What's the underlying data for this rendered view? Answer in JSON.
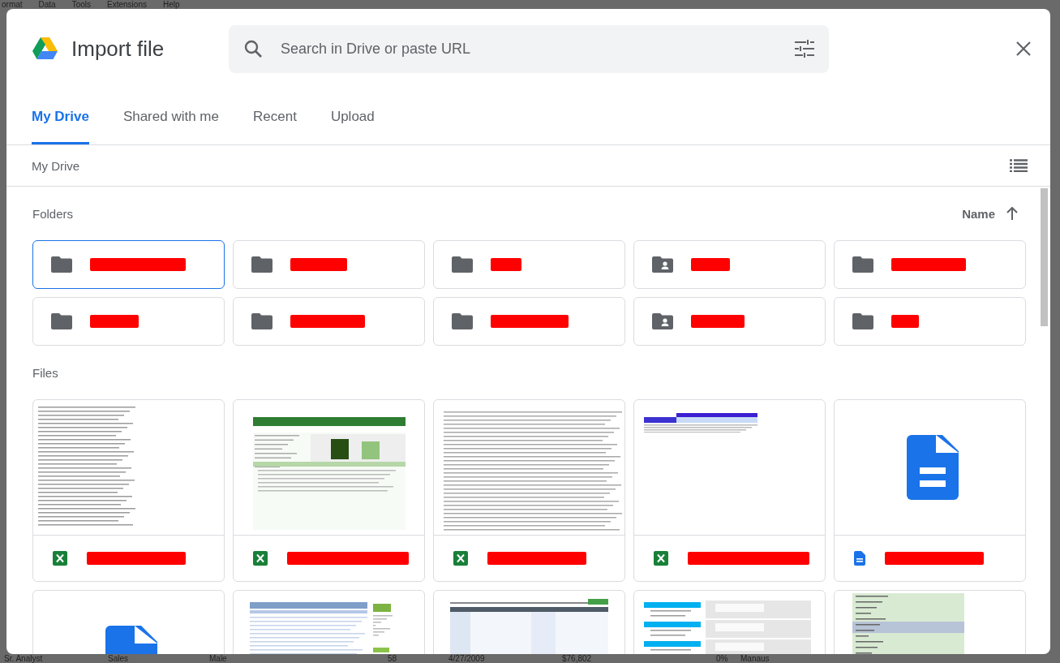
{
  "background": {
    "menu": [
      "ormat",
      "Data",
      "Tools",
      "Extensions",
      "Help"
    ],
    "row": [
      "Sr. Analyst",
      "Sales",
      "Male",
      "58",
      "4/27/2009",
      "$76,802",
      "0%",
      "Manaus"
    ]
  },
  "dialog": {
    "title": "Import file",
    "search": {
      "placeholder": "Search in Drive or paste URL"
    },
    "tabs": [
      {
        "label": "My Drive",
        "selected": true
      },
      {
        "label": "Shared with me",
        "selected": false
      },
      {
        "label": "Recent",
        "selected": false
      },
      {
        "label": "Upload",
        "selected": false
      }
    ],
    "breadcrumb": "My Drive",
    "folders_heading": "Folders",
    "sort": {
      "label": "Name"
    },
    "folders": [
      {
        "kind": "folder",
        "selected": true
      },
      {
        "kind": "folder",
        "selected": false
      },
      {
        "kind": "folder",
        "selected": false
      },
      {
        "kind": "shared",
        "selected": false
      },
      {
        "kind": "folder",
        "selected": false
      },
      {
        "kind": "folder",
        "selected": false
      },
      {
        "kind": "folder",
        "selected": false
      },
      {
        "kind": "folder",
        "selected": false
      },
      {
        "kind": "shared",
        "selected": false
      },
      {
        "kind": "folder",
        "selected": false
      }
    ],
    "files_heading": "Files",
    "files": [
      {
        "kind": "sheet-list",
        "name_redacted": true
      },
      {
        "kind": "sheet-debt",
        "name_redacted": true
      },
      {
        "kind": "sheet-dense",
        "name_redacted": true
      },
      {
        "kind": "sheet-table",
        "name_redacted": true
      },
      {
        "kind": "doc",
        "name_redacted": true
      },
      {
        "kind": "file"
      },
      {
        "kind": "ledger"
      },
      {
        "kind": "grid"
      },
      {
        "kind": "blocks"
      },
      {
        "kind": "days"
      }
    ]
  }
}
